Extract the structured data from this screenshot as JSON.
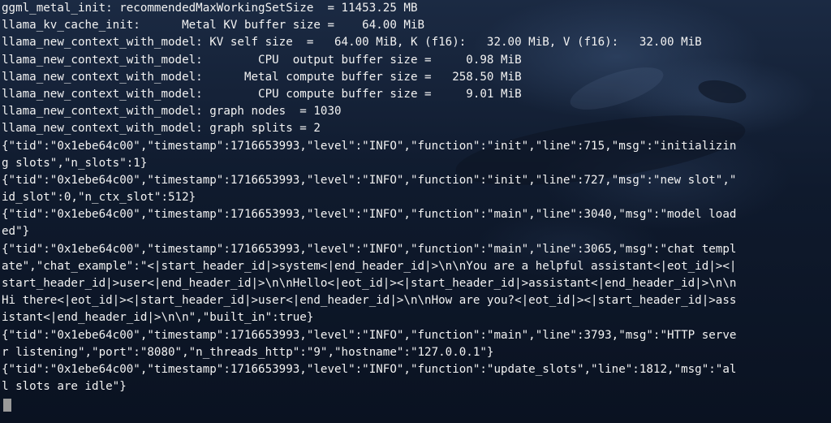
{
  "terminal": {
    "lines": [
      "ggml_metal_init: recommendedMaxWorkingSetSize  = 11453.25 MB",
      "llama_kv_cache_init:      Metal KV buffer size =    64.00 MiB",
      "llama_new_context_with_model: KV self size  =   64.00 MiB, K (f16):   32.00 MiB, V (f16):   32.00 MiB",
      "llama_new_context_with_model:        CPU  output buffer size =     0.98 MiB",
      "llama_new_context_with_model:      Metal compute buffer size =   258.50 MiB",
      "llama_new_context_with_model:        CPU compute buffer size =     9.01 MiB",
      "llama_new_context_with_model: graph nodes  = 1030",
      "llama_new_context_with_model: graph splits = 2",
      "{\"tid\":\"0x1ebe64c00\",\"timestamp\":1716653993,\"level\":\"INFO\",\"function\":\"init\",\"line\":715,\"msg\":\"initializin",
      "g slots\",\"n_slots\":1}",
      "{\"tid\":\"0x1ebe64c00\",\"timestamp\":1716653993,\"level\":\"INFO\",\"function\":\"init\",\"line\":727,\"msg\":\"new slot\",\"",
      "id_slot\":0,\"n_ctx_slot\":512}",
      "{\"tid\":\"0x1ebe64c00\",\"timestamp\":1716653993,\"level\":\"INFO\",\"function\":\"main\",\"line\":3040,\"msg\":\"model load",
      "ed\"}",
      "{\"tid\":\"0x1ebe64c00\",\"timestamp\":1716653993,\"level\":\"INFO\",\"function\":\"main\",\"line\":3065,\"msg\":\"chat templ",
      "ate\",\"chat_example\":\"<|start_header_id|>system<|end_header_id|>\\n\\nYou are a helpful assistant<|eot_id|><|",
      "start_header_id|>user<|end_header_id|>\\n\\nHello<|eot_id|><|start_header_id|>assistant<|end_header_id|>\\n\\n",
      "Hi there<|eot_id|><|start_header_id|>user<|end_header_id|>\\n\\nHow are you?<|eot_id|><|start_header_id|>ass",
      "istant<|end_header_id|>\\n\\n\",\"built_in\":true}",
      "{\"tid\":\"0x1ebe64c00\",\"timestamp\":1716653993,\"level\":\"INFO\",\"function\":\"main\",\"line\":3793,\"msg\":\"HTTP serve",
      "r listening\",\"port\":\"8080\",\"n_threads_http\":\"9\",\"hostname\":\"127.0.0.1\"}",
      "{\"tid\":\"0x1ebe64c00\",\"timestamp\":1716653993,\"level\":\"INFO\",\"function\":\"update_slots\",\"line\":1812,\"msg\":\"al",
      "l slots are idle\"}"
    ]
  }
}
